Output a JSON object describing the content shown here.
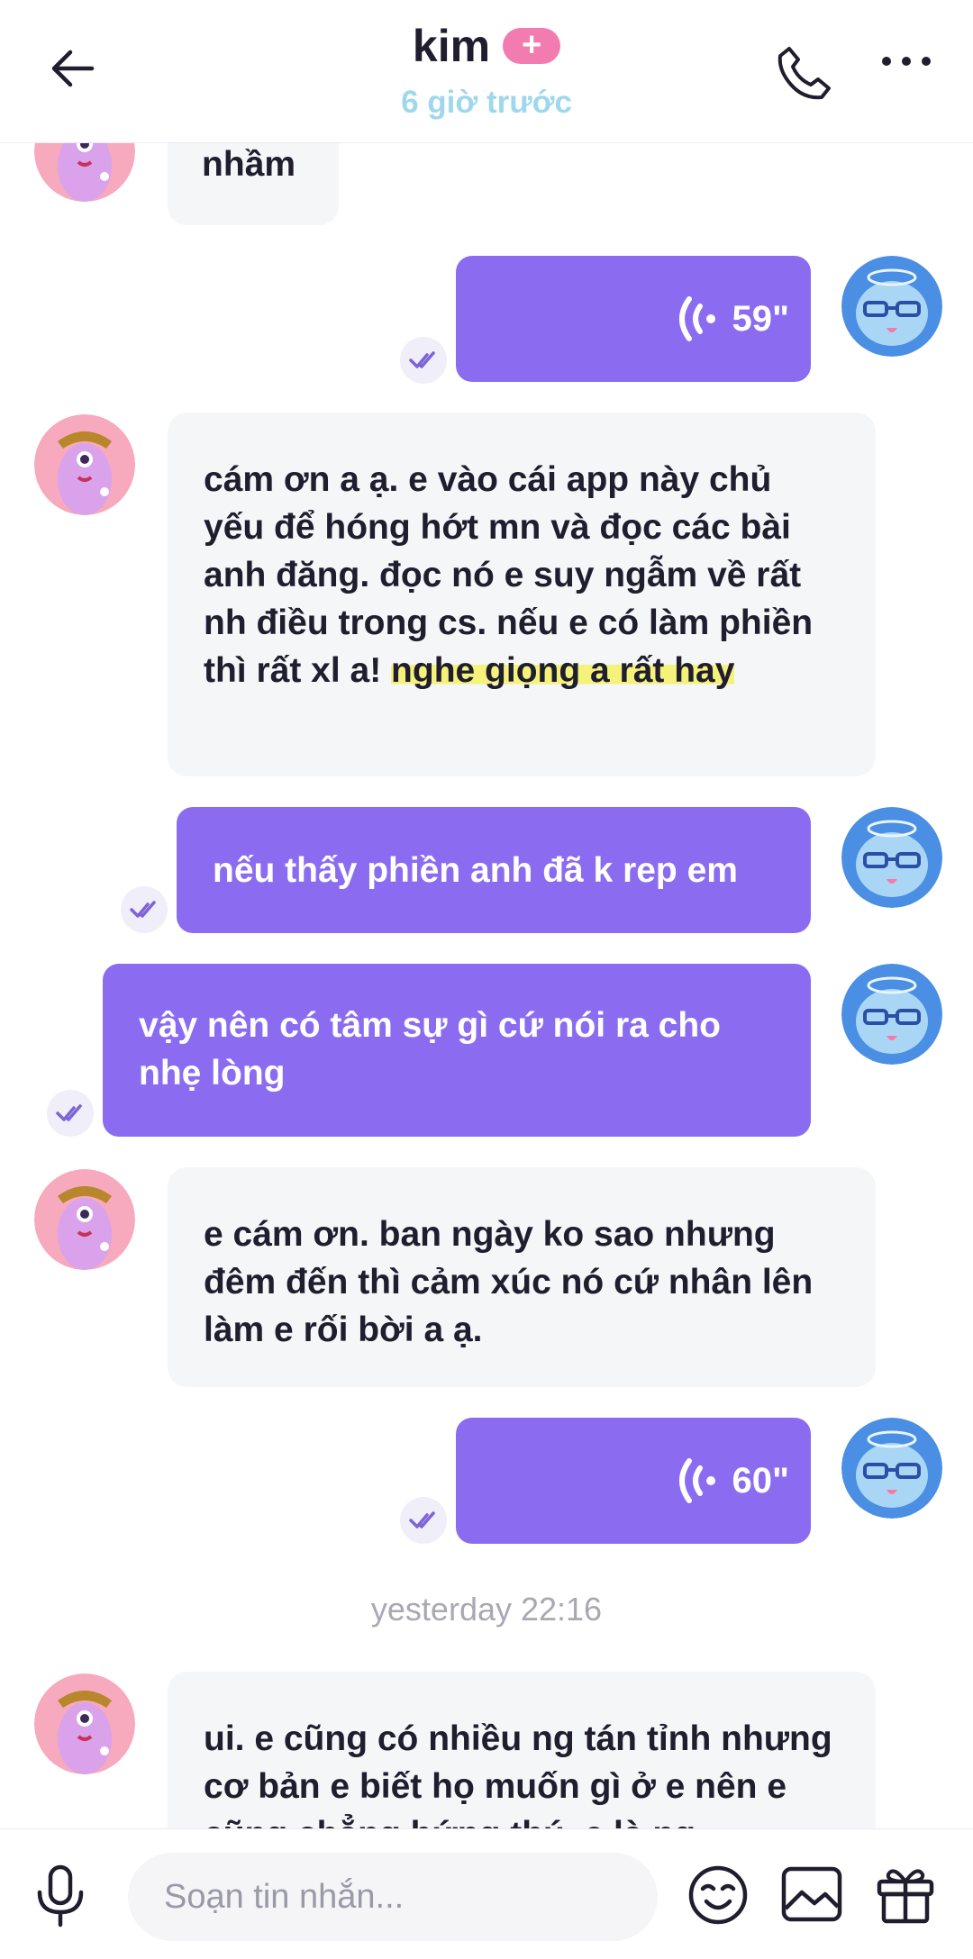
{
  "header": {
    "title": "kim",
    "badge": "+",
    "subtitle": "6 giờ trước",
    "back_icon": "arrow-left-icon",
    "call_icon": "phone-icon",
    "more_icon": "more-horizontal-icon"
  },
  "messages": [
    {
      "direction": "in",
      "text": "nhầm"
    },
    {
      "direction": "out",
      "type": "voice",
      "duration": "59\""
    },
    {
      "direction": "in",
      "text_plain": "cám ơn a ạ. e vào cái app này chủ yếu để hóng hớt mn và đọc các bài anh đăng. đọc nó  e suy ngẫm về rất nh điều trong cs. nếu e có làm phiền thì rất xl a! ",
      "text_highlight": "nghe giọng a rất hay"
    },
    {
      "direction": "out",
      "text": "nếu thấy phiền anh đã k rep em"
    },
    {
      "direction": "out",
      "text": "vậy nên có tâm sự gì cứ nói ra cho nhẹ lòng"
    },
    {
      "direction": "in",
      "text": "e cám ơn. ban ngày ko sao nhưng đêm đến thì cảm xúc nó cứ nhân lên làm e rối bời a ạ."
    },
    {
      "direction": "out",
      "type": "voice",
      "duration": "60\""
    },
    {
      "direction": "in",
      "text": "ui. e cũng có nhiều ng tán tỉnh nhưng cơ bản e biết họ muốn gì ở e nên e cũng chẳng hứng thú. e là ng"
    }
  ],
  "timestamp": "yesterday 22:16",
  "composer": {
    "placeholder": "Soạn tin nhắn...",
    "mic_icon": "microphone-icon",
    "emoji_icon": "smiley-icon",
    "image_icon": "image-icon",
    "gift_icon": "gift-icon"
  },
  "colors": {
    "outgoing_bubble": "#8b6cf0",
    "incoming_bubble": "#f5f6f8",
    "subtitle": "#9fd8ec",
    "badge": "#f27cb0",
    "highlight": "#f4f27a"
  }
}
